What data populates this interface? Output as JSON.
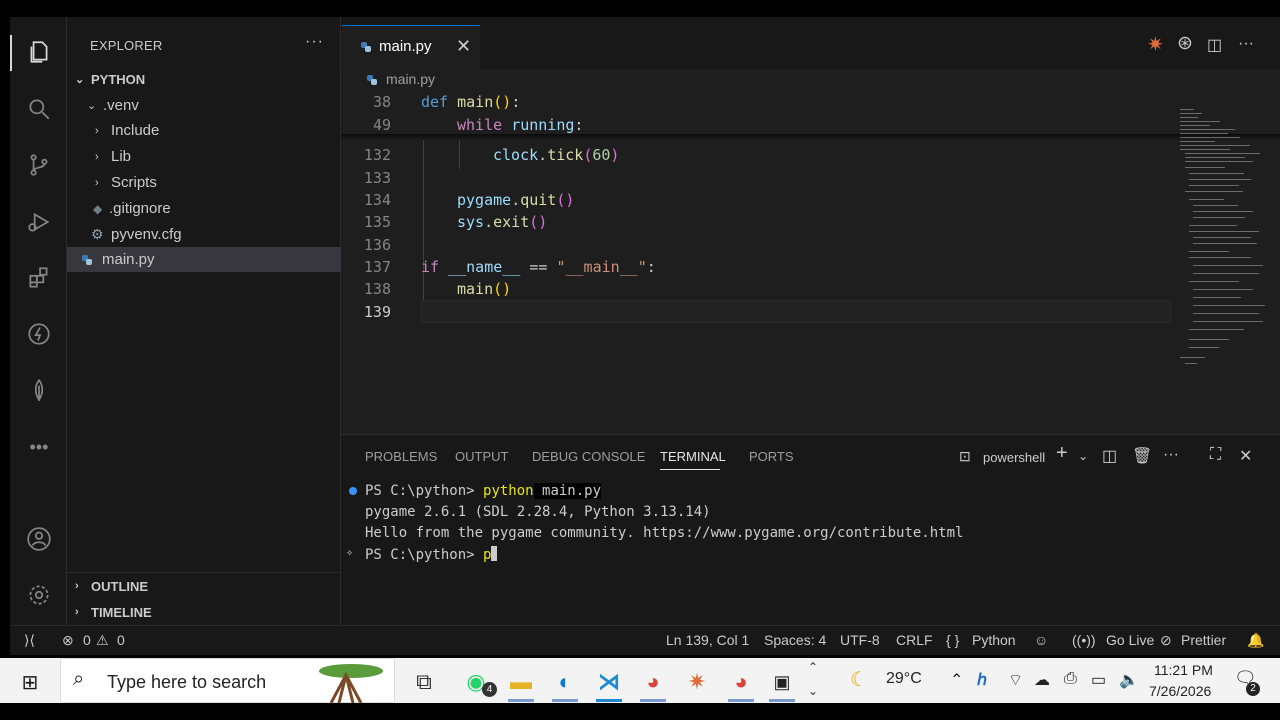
{
  "explorer": {
    "title": "EXPLORER",
    "more": "···",
    "root": "PYTHON",
    "items": [
      {
        "label": ".venv",
        "type": "folder-open"
      },
      {
        "label": "Include",
        "type": "folder"
      },
      {
        "label": "Lib",
        "type": "folder"
      },
      {
        "label": "Scripts",
        "type": "folder"
      },
      {
        "label": ".gitignore",
        "type": "file"
      },
      {
        "label": "pyvenv.cfg",
        "type": "gear-file"
      },
      {
        "label": "main.py",
        "type": "python-file"
      }
    ],
    "sections": [
      "OUTLINE",
      "TIMELINE"
    ]
  },
  "tab": {
    "label": "main.py",
    "close": "✕"
  },
  "breadcrumb": {
    "label": "main.py"
  },
  "editor": {
    "sticky": [
      {
        "num": "38",
        "text": "def main():"
      },
      {
        "num": "49",
        "text": "while running:"
      }
    ],
    "lines": [
      {
        "num": "132",
        "text": "clock.tick(60)"
      },
      {
        "num": "133",
        "text": ""
      },
      {
        "num": "134",
        "text": "pygame.quit()"
      },
      {
        "num": "135",
        "text": "sys.exit()"
      },
      {
        "num": "136",
        "text": ""
      },
      {
        "num": "137",
        "text": "if __name__ == \"__main__\":"
      },
      {
        "num": "138",
        "text": "main()"
      },
      {
        "num": "139",
        "text": ""
      }
    ]
  },
  "panel": {
    "tabs": [
      "PROBLEMS",
      "OUTPUT",
      "DEBUG CONSOLE",
      "TERMINAL",
      "PORTS"
    ],
    "active_tab": "TERMINAL",
    "shell": "powershell",
    "terminal": [
      "PS C:\\python> python main.py",
      "pygame 2.6.1 (SDL 2.28.4, Python 3.13.14)",
      "Hello from the pygame community. https://www.pygame.org/contribute.html",
      "PS C:\\python> p"
    ]
  },
  "status": {
    "errors": "0",
    "warnings": "0",
    "position": "Ln 139, Col 1",
    "spaces": "Spaces: 4",
    "encoding": "UTF-8",
    "eol": "CRLF",
    "language": "Python",
    "golive": "Go Live",
    "prettier": "Prettier"
  },
  "taskbar": {
    "search_placeholder": "Type here to search",
    "whatsapp_badge": "4",
    "weather": "29°C",
    "time": "11:21 PM",
    "date": "7/26/2026",
    "notifications": "2"
  },
  "colors": {
    "accent": "#0078d4",
    "editor_bg": "#1e1e1e",
    "sidebar_bg": "#181818"
  }
}
